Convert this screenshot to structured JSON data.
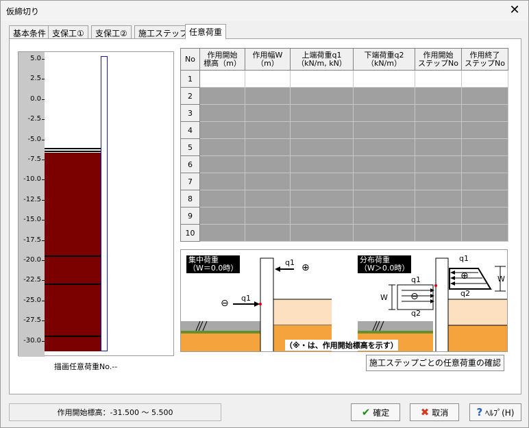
{
  "window": {
    "title": "仮締切り"
  },
  "tabs": [
    "基本条件",
    "支保工①",
    "支保工②",
    "施工ステップ",
    "任意荷重"
  ],
  "plot": {
    "ticks": [
      "5.0",
      "2.5",
      "0.0",
      "-2.5",
      "-5.0",
      "-7.5",
      "-10.0",
      "-12.5",
      "-15.0",
      "-17.5",
      "-20.0",
      "-22.5",
      "-25.0",
      "-27.5",
      "-30.0"
    ],
    "caption": "描画任意荷重No.--",
    "soil_color": "#7b0000"
  },
  "table": {
    "headers": [
      "No",
      "作用開始\n標高（m）",
      "作用幅W\n（m）",
      "上端荷重q1\n（kN/m, kN）",
      "下端荷重q2\n（kN/m）",
      "作用開始\nステップNo",
      "作用終了\nステップNo"
    ],
    "rows": [
      "1",
      "2",
      "3",
      "4",
      "5",
      "6",
      "7",
      "8",
      "9",
      "10"
    ]
  },
  "diagram": {
    "left_title_1": "集中荷重",
    "left_title_2": "（W＝0.0時）",
    "right_title_1": "分布荷重",
    "right_title_2": "（W＞0.0時）",
    "q1": "q1",
    "q2": "q2",
    "w": "W",
    "plus": "⊕",
    "minus": "⊖",
    "note": "（※・は、作用開始標高を示す）"
  },
  "buttons": {
    "confirm_loads": "施工ステップごとの任意荷重の確認",
    "ok": "確定",
    "cancel": "取消",
    "help": "ﾍﾙﾌﾟ(H)"
  },
  "status": "作用開始標高：-31.500 〜 5.500"
}
